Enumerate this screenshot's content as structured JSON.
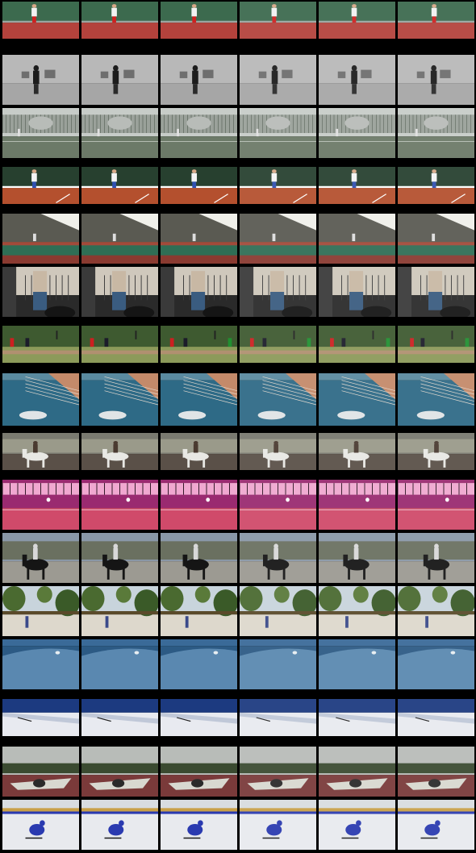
{
  "grid": {
    "columns": 6,
    "rows": [
      {
        "scene": "tennis-player-red-court",
        "sky": "#3c6a4e",
        "ground": "#b4423c",
        "accent": "#9aa5a0",
        "figure": "#f2f2f2",
        "figure2": "#d02020",
        "kind": "player"
      },
      {
        "scene": "person-walking-street-gray",
        "sky": "#b8b8b8",
        "ground": "#a6a6a6",
        "accent": "#6e6e6e",
        "figure": "#1c1c1c",
        "figure2": "#2a2a2a",
        "kind": "walker"
      },
      {
        "scene": "tennis-court-fence-green",
        "sky": "#c7ccc8",
        "ground": "#6c7a68",
        "accent": "#3d4a3d",
        "figure": "#e0e0e0",
        "figure2": "#101010",
        "kind": "court"
      },
      {
        "scene": "clay-court-player-white",
        "sky": "#27402f",
        "ground": "#b4502e",
        "accent": "#ffffff",
        "figure": "#f5f5f5",
        "figure2": "#3050b0",
        "kind": "player"
      },
      {
        "scene": "indoor-tennis-dome",
        "sky": "#5a5a52",
        "ground": "#2f6e55",
        "accent": "#a24a3a",
        "figure": "#dddddd",
        "figure2": "#e6e2d8",
        "kind": "dome"
      },
      {
        "scene": "interior-balcony-person",
        "sky": "#cfc8bc",
        "ground": "#2a2a2a",
        "accent": "#4e6f8a",
        "figure": "#3a5c80",
        "figure2": "#6a5a4a",
        "kind": "interior"
      },
      {
        "scene": "cricket-field-players",
        "sky": "#3e5a30",
        "ground": "#8c9a5a",
        "accent": "#b09070",
        "figure": "#cc2020",
        "figure2": "#209030",
        "kind": "cricket"
      },
      {
        "scene": "swimming-pool-diver",
        "sky": "#5a8aa0",
        "ground": "#2e6a86",
        "accent": "#c48a6a",
        "figure": "#e0e4e6",
        "figure2": "#d8b8a0",
        "kind": "pool"
      },
      {
        "scene": "rider-white-horse",
        "sky": "#7a7a70",
        "ground": "#5a5048",
        "accent": "#9a9a8a",
        "figure": "#e8e8e4",
        "figure2": "#4a3a30",
        "kind": "horse"
      },
      {
        "scene": "indoor-basketball-pink",
        "sky": "#9a2a70",
        "ground": "#d04a6a",
        "accent": "#f0a8d0",
        "figure": "#ffffff",
        "figure2": "#2a1020",
        "kind": "gym"
      },
      {
        "scene": "rider-black-horse-arena",
        "sky": "#8a98a8",
        "ground": "#9c9a92",
        "accent": "#6a7060",
        "figure": "#151515",
        "figure2": "#d8d8d8",
        "kind": "horse"
      },
      {
        "scene": "garden-runner-trees",
        "sky": "#c8d4dc",
        "ground": "#ddd8cc",
        "accent": "#4a6a30",
        "figure": "#3a4a8a",
        "figure2": "#5a4a2a",
        "kind": "garden"
      },
      {
        "scene": "ocean-wave-surfer",
        "sky": "#3a6a98",
        "ground": "#2c5a84",
        "accent": "#5a88b0",
        "figure": "#e8eef2",
        "figure2": "#ffffff",
        "kind": "wave"
      },
      {
        "scene": "snow-slope-skier",
        "sky": "#1c3a80",
        "ground": "#e8eaf0",
        "accent": "#c0c8d8",
        "figure": "#202020",
        "figure2": "#ffffff",
        "kind": "ski"
      },
      {
        "scene": "motocross-dirt-track",
        "sky": "#b8bcb8",
        "ground": "#7a3a3a",
        "accent": "#3a4a30",
        "figure": "#2a2a2a",
        "figure2": "#d8d8d0",
        "kind": "moto"
      },
      {
        "scene": "ice-rink-skater-blue",
        "sky": "#d8dce0",
        "ground": "#e8eaee",
        "accent": "#c8a048",
        "figure": "#2a3ab0",
        "figure2": "#1a1a1a",
        "kind": "skater"
      }
    ]
  }
}
